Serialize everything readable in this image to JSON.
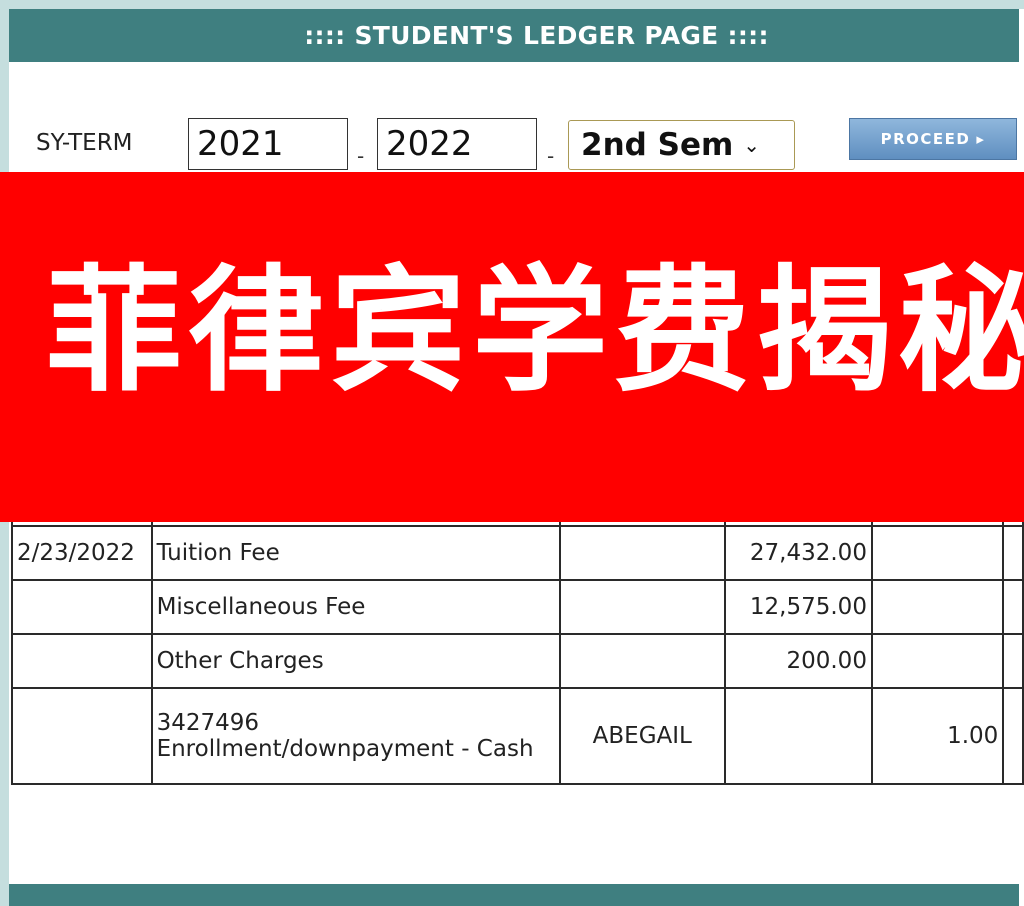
{
  "header": {
    "title": ":::: STUDENT'S LEDGER PAGE ::::"
  },
  "form": {
    "syterm_label": "SY-TERM",
    "year_start": "2021",
    "year_end": "2022",
    "separator": "-",
    "semester": "2nd Sem",
    "proceed_label": "PROCEED"
  },
  "ledger": {
    "rows": [
      {
        "date": "2/23/2022",
        "description": "Tuition Fee",
        "by": "",
        "debit": "27,432.00",
        "credit": ""
      },
      {
        "date": "",
        "description": "Miscellaneous Fee",
        "by": "",
        "debit": "12,575.00",
        "credit": ""
      },
      {
        "date": "",
        "description": "Other Charges",
        "by": "",
        "debit": "200.00",
        "credit": ""
      },
      {
        "date": "",
        "description": "3427496 Enrollment/downpayment - Cash",
        "by": "ABEGAIL",
        "debit": "",
        "credit": "1.00"
      }
    ]
  },
  "overlay": {
    "text": "菲律宾学费揭秘"
  },
  "colors": {
    "teal": "#3f7f80",
    "overlay_red": "#ff0000",
    "button_blue": "#6f9fcf"
  }
}
